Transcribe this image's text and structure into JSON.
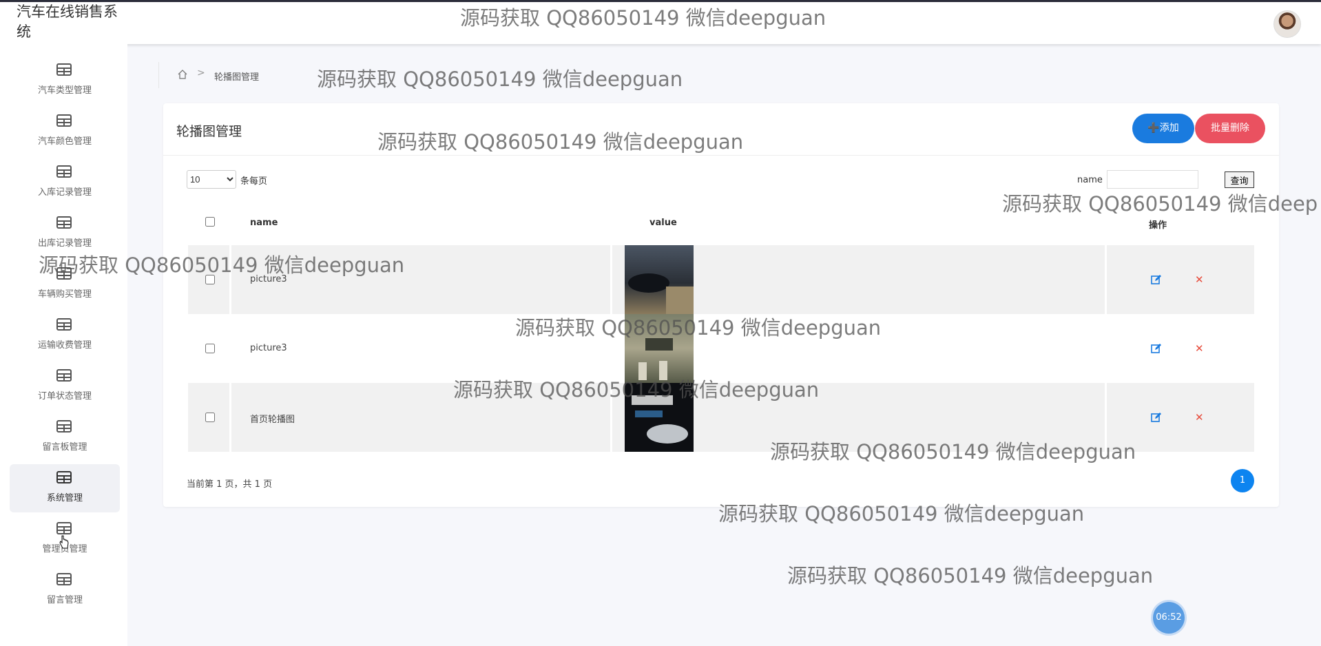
{
  "header": {
    "app_title": "汽车在线销售系统"
  },
  "sidebar": {
    "items": [
      {
        "label": "汽车类型管理"
      },
      {
        "label": "汽车颜色管理"
      },
      {
        "label": "入库记录管理"
      },
      {
        "label": "出库记录管理"
      },
      {
        "label": "车辆购买管理"
      },
      {
        "label": "运输收费管理"
      },
      {
        "label": "订单状态管理"
      },
      {
        "label": "留言板管理"
      },
      {
        "label": "系统管理",
        "active": true
      },
      {
        "label": "管理员管理"
      },
      {
        "label": "留言管理"
      }
    ]
  },
  "breadcrumb": {
    "separator": ">",
    "current": "轮播图管理"
  },
  "card": {
    "title": "轮播图管理",
    "add_label": "➕添加",
    "batch_delete_label": "批量删除",
    "page_size": {
      "selected": "10",
      "options": [
        "10"
      ],
      "suffix": "条每页"
    },
    "search": {
      "label": "name",
      "value": "",
      "button_label": "查询"
    },
    "table": {
      "columns": [
        "name",
        "value",
        "操作"
      ],
      "rows": [
        {
          "name": "picture3",
          "image": "dark car on dirt road"
        },
        {
          "name": "picture3",
          "image": "rally car on road"
        },
        {
          "name": "首页轮播图",
          "image": "car banner"
        }
      ],
      "edit_icon": "edit-icon",
      "delete_icon": "close-icon"
    },
    "pagination": {
      "info": "当前第 1 页，共 1 页",
      "current_page": "1"
    }
  },
  "clock": {
    "time": "06:52"
  },
  "watermark": {
    "text": "源码获取 QQ86050149 微信deepguan",
    "text_cut": "源码获取 QQ86050149 微信deep"
  }
}
